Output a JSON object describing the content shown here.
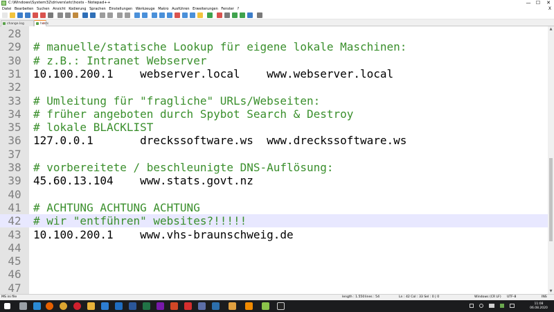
{
  "window": {
    "title": "C:\\Windows\\System32\\drivers\\etc\\hosts - Notepad++",
    "controls": {
      "minimize": "—",
      "maximize": "☐",
      "close": "✕"
    }
  },
  "menu": {
    "items": [
      "Datei",
      "Bearbeiten",
      "Suchen",
      "Ansicht",
      "Kodierung",
      "Sprachen",
      "Einstellungen",
      "Werkzeuge",
      "Makro",
      "Ausführen",
      "Erweiterungen",
      "Fenster",
      "?"
    ],
    "close": "X"
  },
  "toolbar": {
    "icons": [
      {
        "name": "new-file-icon",
        "color": "#e7e7e7"
      },
      {
        "name": "open-file-icon",
        "color": "#f2c33d"
      },
      {
        "name": "save-icon",
        "color": "#3c7dc9"
      },
      {
        "name": "save-all-icon",
        "color": "#3c7dc9"
      },
      {
        "name": "close-icon",
        "color": "#d9534f"
      },
      {
        "name": "close-all-icon",
        "color": "#d9534f"
      },
      {
        "name": "print-icon",
        "color": "#7a7a7a"
      },
      {
        "name": "cut-icon",
        "color": "#8a8a8a"
      },
      {
        "name": "copy-icon",
        "color": "#8a8a8a"
      },
      {
        "name": "paste-icon",
        "color": "#c08a3e"
      },
      {
        "name": "undo-icon",
        "color": "#2f6fb7"
      },
      {
        "name": "redo-icon",
        "color": "#2f6fb7"
      },
      {
        "name": "find-icon",
        "color": "#9c9c9c"
      },
      {
        "name": "replace-icon",
        "color": "#9c9c9c"
      },
      {
        "name": "zoom-in-icon",
        "color": "#9c9c9c"
      },
      {
        "name": "zoom-out-icon",
        "color": "#9c9c9c"
      },
      {
        "name": "sync-v-icon",
        "color": "#4a90d9"
      },
      {
        "name": "sync-h-icon",
        "color": "#4a90d9"
      },
      {
        "name": "wrap-icon",
        "color": "#4a90d9"
      },
      {
        "name": "all-chars-icon",
        "color": "#4a90d9"
      },
      {
        "name": "indent-guide-icon",
        "color": "#4a90d9"
      },
      {
        "name": "udl-icon",
        "color": "#d9534f"
      },
      {
        "name": "doc-map-icon",
        "color": "#4a90d9"
      },
      {
        "name": "function-list-icon",
        "color": "#4a90d9"
      },
      {
        "name": "folder-workspace-icon",
        "color": "#f2c33d"
      },
      {
        "name": "monitoring-icon",
        "color": "#3fa34d"
      },
      {
        "name": "record-macro-icon",
        "color": "#d9534f"
      },
      {
        "name": "stop-macro-icon",
        "color": "#7a7a7a"
      },
      {
        "name": "play-macro-icon",
        "color": "#3fa34d"
      },
      {
        "name": "run-macro-multiple-icon",
        "color": "#3fa34d"
      },
      {
        "name": "save-macro-icon",
        "color": "#3c7dc9"
      },
      {
        "name": "spellcheck-icon",
        "color": "#7a7a7a"
      }
    ]
  },
  "tabs": [
    {
      "label": "change.log",
      "active": false
    },
    {
      "label": "hosts",
      "active": true
    }
  ],
  "editor": {
    "current_line": 42,
    "lines": [
      {
        "num": "28",
        "text": "",
        "type": "plain"
      },
      {
        "num": "29",
        "text": "# manuelle/statische Lookup für eigene lokale Maschinen:",
        "type": "comment"
      },
      {
        "num": "30",
        "text": "# z.B.: Intranet Webserver",
        "type": "comment"
      },
      {
        "num": "31",
        "text": "10.100.200.1    webserver.local    www.webserver.local",
        "type": "plain"
      },
      {
        "num": "32",
        "text": "",
        "type": "plain"
      },
      {
        "num": "33",
        "text": "# Umleitung für \"fragliche\" URLs/Webseiten:",
        "type": "comment"
      },
      {
        "num": "34",
        "text": "# früher angeboten durch Spybot Search & Destroy",
        "type": "comment"
      },
      {
        "num": "35",
        "text": "# lokale BLACKLIST",
        "type": "comment"
      },
      {
        "num": "36",
        "text": "127.0.0.1       dreckssoftware.ws  www.dreckssoftware.ws",
        "type": "plain"
      },
      {
        "num": "37",
        "text": "",
        "type": "plain"
      },
      {
        "num": "38",
        "text": "# vorbereitete / beschleunigte DNS-Auflösung:",
        "type": "comment"
      },
      {
        "num": "39",
        "text": "45.60.13.104    www.stats.govt.nz",
        "type": "plain"
      },
      {
        "num": "40",
        "text": "",
        "type": "plain"
      },
      {
        "num": "41",
        "text": "# ACHTUNG ACHTUNG ACHTUNG",
        "type": "comment"
      },
      {
        "num": "42",
        "text": "# wir \"entführen\" websites?!!!!!",
        "type": "comment"
      },
      {
        "num": "43",
        "text": "10.100.200.1    www.vhs-braunschweig.de",
        "type": "plain"
      },
      {
        "num": "44",
        "text": "",
        "type": "plain"
      },
      {
        "num": "45",
        "text": "",
        "type": "plain"
      },
      {
        "num": "46",
        "text": "",
        "type": "plain"
      },
      {
        "num": "47",
        "text": "",
        "type": "plain"
      }
    ]
  },
  "scrollbar": {
    "up": "▲",
    "down": "▼"
  },
  "status": {
    "file_type": "MS ini file",
    "length": "length : 1.550",
    "lines": "lines : 54",
    "position": "Ln : 42    Col : 33    Sel : 0 | 0",
    "eol": "Windows (CR LF)",
    "encoding": "UTF-8",
    "mode": "INS"
  },
  "taskbar": {
    "icons": [
      {
        "name": "windows-start-icon",
        "color": "#ffffff"
      },
      {
        "name": "task-view-icon",
        "color": "#9aa0a6"
      },
      {
        "name": "edge-icon",
        "color": "#2a8ad4"
      },
      {
        "name": "firefox-icon",
        "color": "#e66000"
      },
      {
        "name": "chrome-icon",
        "color": "#dba531"
      },
      {
        "name": "opera-icon",
        "color": "#d0202e"
      },
      {
        "name": "folder-icon",
        "color": "#e8b23a"
      },
      {
        "name": "mail-icon",
        "color": "#2d7dd2"
      },
      {
        "name": "outlook-icon",
        "color": "#1f6dc1"
      },
      {
        "name": "word-icon",
        "color": "#2b579a"
      },
      {
        "name": "excel-icon",
        "color": "#217346"
      },
      {
        "name": "onenote-icon",
        "color": "#7719aa"
      },
      {
        "name": "powerpoint-icon",
        "color": "#d24726"
      },
      {
        "name": "acrobat-icon",
        "color": "#d62e2e"
      },
      {
        "name": "putty-icon",
        "color": "#5c6ea8"
      },
      {
        "name": "terminal-icon",
        "color": "#2c6fad"
      },
      {
        "name": "paint-icon",
        "color": "#e0a040"
      },
      {
        "name": "vlc-icon",
        "color": "#f08a00"
      },
      {
        "name": "notepadpp-icon",
        "color": "#8bc34a"
      },
      {
        "name": "cmd-icon",
        "color": "#222222"
      }
    ],
    "time": "11:08",
    "date": "06.08.2020"
  }
}
